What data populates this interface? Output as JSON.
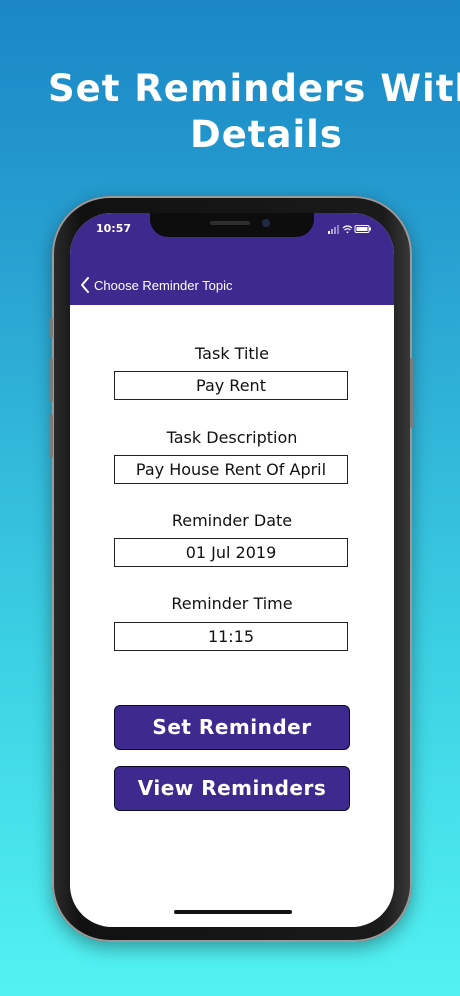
{
  "headline": {
    "line1": "Set Reminders With",
    "line2": "Details"
  },
  "status_bar": {
    "time": "10:57",
    "icons": [
      "signal-icon",
      "wifi-icon",
      "battery-icon"
    ]
  },
  "nav": {
    "back_label": "Choose Reminder Topic",
    "back_icon": "chevron-left-icon"
  },
  "form": {
    "task_title": {
      "label": "Task Title",
      "value": "Pay Rent"
    },
    "task_description": {
      "label": "Task Description",
      "value": "Pay House Rent Of April"
    },
    "reminder_date": {
      "label": "Reminder Date",
      "value": "01 Jul 2019"
    },
    "reminder_time": {
      "label": "Reminder Time",
      "value": "11:15"
    }
  },
  "buttons": {
    "set_reminder": "Set Reminder",
    "view_reminders": "View Reminders"
  },
  "colors": {
    "brand_purple": "#3e2a8f",
    "background_top": "#1a86c6",
    "background_bottom": "#52f2f2"
  }
}
